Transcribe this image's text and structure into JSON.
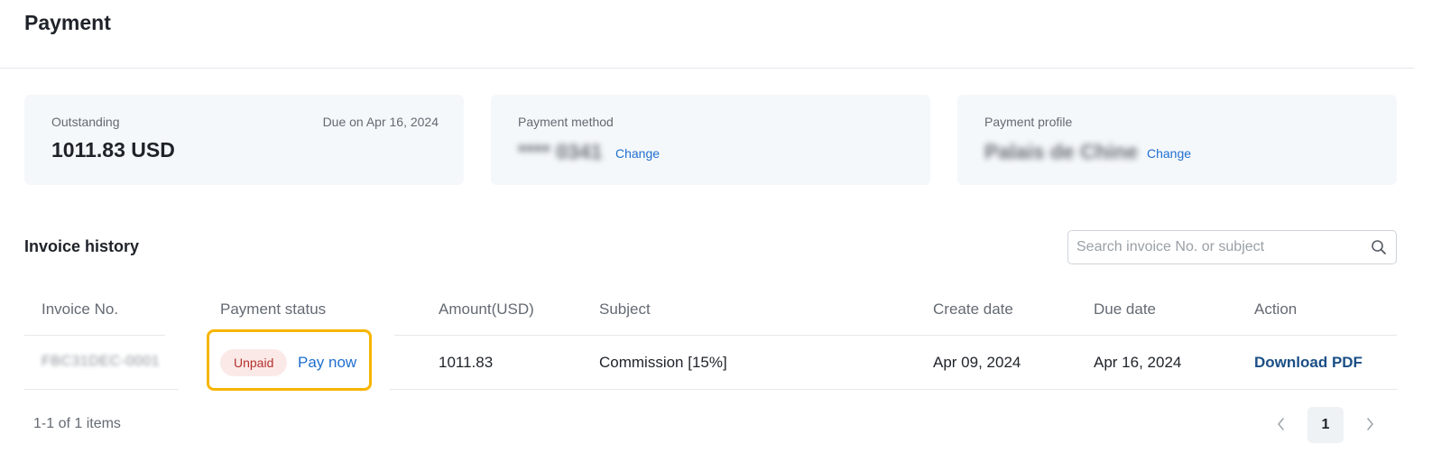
{
  "page": {
    "title": "Payment"
  },
  "summary": {
    "outstanding": {
      "label": "Outstanding",
      "due": "Due on Apr 16, 2024",
      "amount": "1011.83 USD"
    },
    "payment_method": {
      "label": "Payment method",
      "value": "**** 0341",
      "change_label": "Change"
    },
    "payment_profile": {
      "label": "Payment profile",
      "value": "Palais de Chine",
      "change_label": "Change"
    }
  },
  "invoice_history": {
    "title": "Invoice history",
    "search": {
      "placeholder": "Search invoice No. or subject",
      "value": ""
    },
    "columns": [
      "Invoice No.",
      "Payment status",
      "Amount(USD)",
      "Subject",
      "Create date",
      "Due date",
      "Action"
    ],
    "rows": [
      {
        "invoice_no": "FBC31DEC-0001",
        "status": "Unpaid",
        "pay_label": "Pay now",
        "amount": "1011.83",
        "subject": "Commission [15%]",
        "create_date": "Apr 09, 2024",
        "due_date": "Apr 16, 2024",
        "action": "Download PDF"
      }
    ],
    "pagination": {
      "summary": "1-1 of 1 items",
      "current_page": "1"
    }
  },
  "icons": {
    "search": "search-icon",
    "prev": "chevron-left-icon",
    "next": "chevron-right-icon"
  },
  "colors": {
    "link": "#1f6fcf",
    "highlight": "#f7b500",
    "unpaid_text": "#b4312d",
    "unpaid_bg": "#fbe9e8"
  }
}
